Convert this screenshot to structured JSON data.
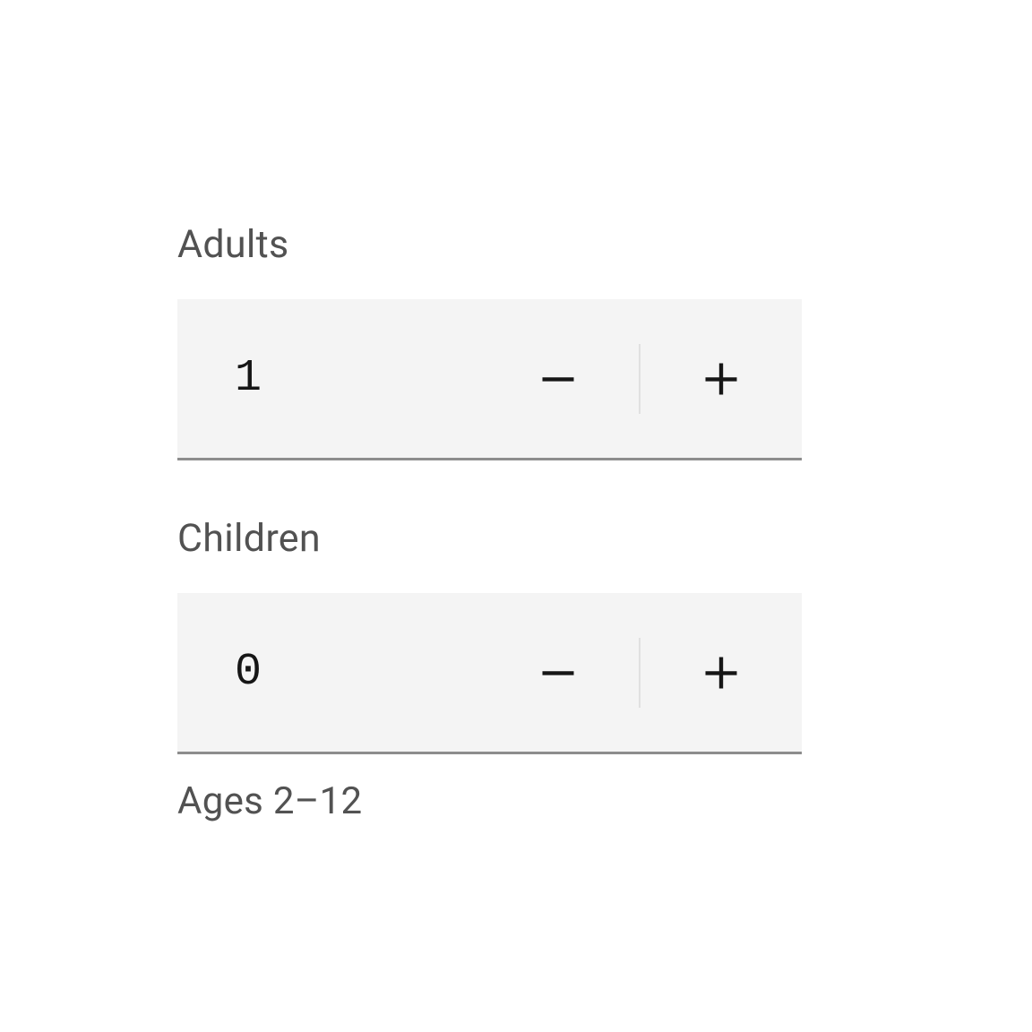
{
  "adults": {
    "label": "Adults",
    "value": "1"
  },
  "children": {
    "label": "Children",
    "value": "0",
    "helper": "Ages 2–12"
  }
}
